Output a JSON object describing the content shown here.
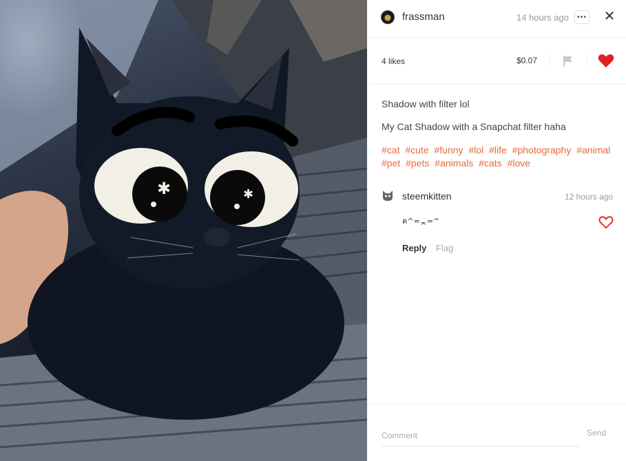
{
  "post": {
    "author": "frassman",
    "time": "14 hours ago",
    "more_label": "•••",
    "close_label": "✕",
    "likes": "4 likes",
    "payout": "$0.07",
    "title": "Shadow with filter lol",
    "body": "My Cat Shadow with a Snapchat filter haha",
    "tags": [
      "#cat",
      "#cute",
      "#funny",
      "#lol",
      "#life",
      "#photography",
      "#animal",
      "#pet",
      "#pets",
      "#animals",
      "#cats",
      "#love"
    ],
    "liked": true
  },
  "comment": {
    "author": "steemkitten",
    "time": "12 hours ago",
    "text": "ฅ^=ᆽ=^",
    "reply_label": "Reply",
    "flag_label": "Flag"
  },
  "footer": {
    "placeholder": "Comment",
    "send_label": "Send"
  },
  "colors": {
    "heart": "#e02020",
    "tag": "#e56a3c"
  },
  "icons": [
    "avatar",
    "more-icon",
    "close-icon",
    "flag-icon",
    "heart-icon",
    "cat-avatar-icon",
    "heart-outline-icon"
  ]
}
